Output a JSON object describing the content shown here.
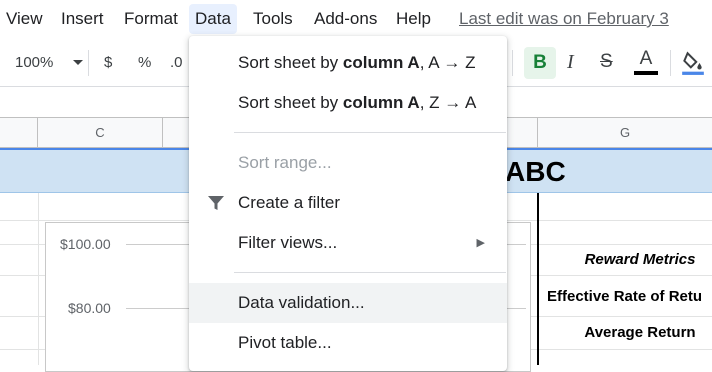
{
  "menubar": {
    "items": [
      "View",
      "Insert",
      "Format",
      "Data",
      "Tools",
      "Add-ons",
      "Help"
    ],
    "active": "Data",
    "last_edit": "Last edit was on February 3"
  },
  "toolbar": {
    "zoom": "100%",
    "currency": "$",
    "percent": "%",
    "decimal": ".0",
    "bold": "B",
    "italic": "I",
    "strike": "S",
    "text_color": "A"
  },
  "grid": {
    "col_c": "C",
    "col_g": "G",
    "title_fragment": "ABC",
    "chart_ticks": [
      "$100.00",
      "$80.00"
    ],
    "metrics": [
      "Reward Metrics",
      "Effective Rate of Retu",
      "Average Return"
    ]
  },
  "data_menu": {
    "items": [
      {
        "label_prefix": "Sort sheet by ",
        "label_bold": "column A",
        "label_suffix": ", A → Z"
      },
      {
        "label_prefix": "Sort sheet by ",
        "label_bold": "column A",
        "label_suffix": ", Z → A"
      },
      {
        "label": "Sort range..."
      },
      {
        "label": "Create a filter"
      },
      {
        "label": "Filter views..."
      },
      {
        "label": "Data validation..."
      },
      {
        "label": "Pivot table..."
      }
    ]
  },
  "colors": {
    "accent": "#1a73e8",
    "active_menu_bg": "#e8f0fe",
    "title_band": "#cfe2f3",
    "bold_btn_bg": "#e6f4ea",
    "bold_btn_fg": "#188038"
  }
}
